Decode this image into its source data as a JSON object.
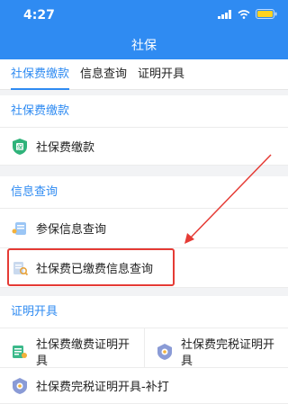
{
  "status_bar": {
    "time": "4:27"
  },
  "header": {
    "title": "社保"
  },
  "tabs": [
    {
      "label": "社保费缴款",
      "active": true
    },
    {
      "label": "信息查询",
      "active": false
    },
    {
      "label": "证明开具",
      "active": false
    }
  ],
  "sections": {
    "payment": {
      "title": "社保费缴款",
      "items": [
        "社保费缴款"
      ]
    },
    "query": {
      "title": "信息查询",
      "items": [
        "参保信息查询",
        "社保费已缴费信息查询"
      ]
    },
    "certificate": {
      "title": "证明开具",
      "items": [
        "社保费缴费证明开具",
        "社保费完税证明开具",
        "社保费完税证明开具-补打"
      ]
    }
  },
  "colors": {
    "accent": "#2f8bf2",
    "annotation": "#e53b35"
  }
}
